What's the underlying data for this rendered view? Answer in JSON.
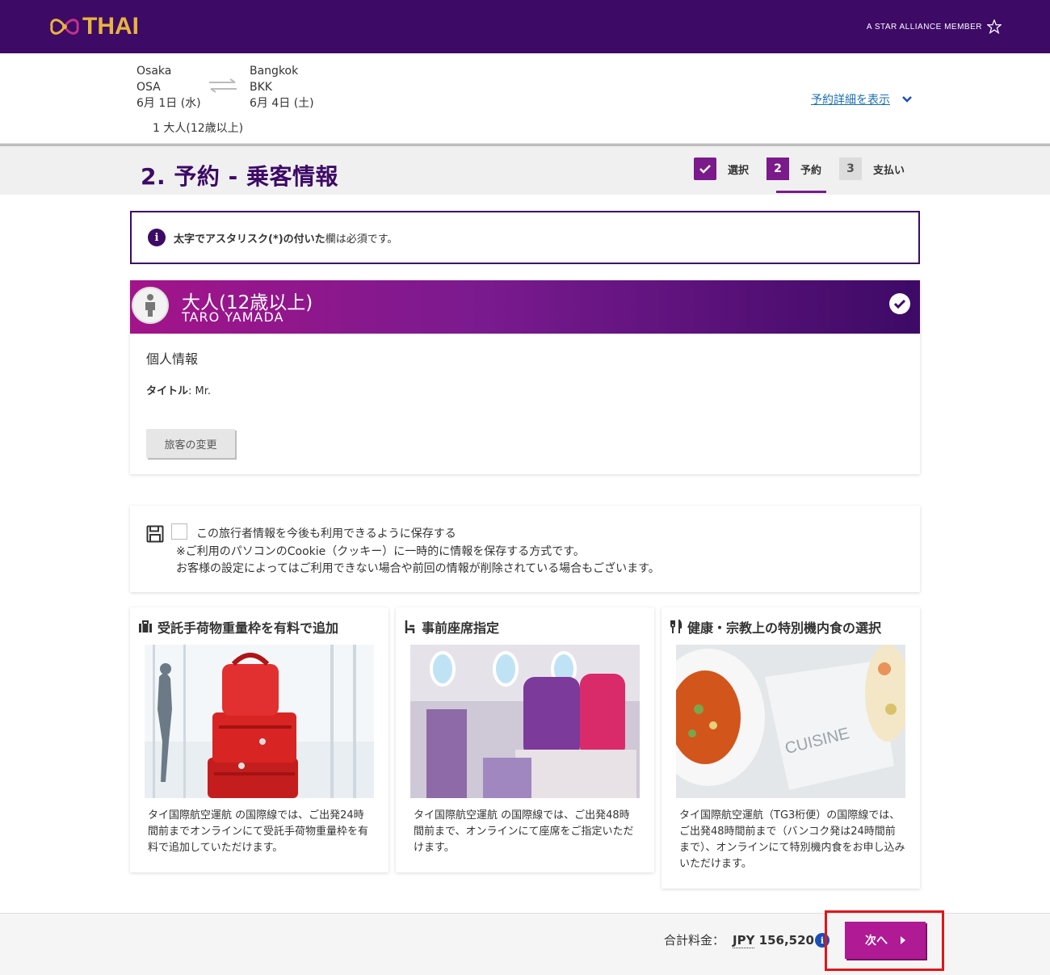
{
  "header": {
    "logo_text": "THAI",
    "alliance_text": "A STAR ALLIANCE MEMBER"
  },
  "trip": {
    "from": {
      "city": "Osaka",
      "code": "OSA",
      "date": "6月 1日 (水)"
    },
    "to": {
      "city": "Bangkok",
      "code": "BKK",
      "date": "6月 4日 (土)"
    },
    "passengers": "1 大人(12歳以上)",
    "details_link": "予約詳細を表示"
  },
  "page": {
    "title": "2. 予約 - 乗客情報",
    "steps": [
      {
        "number": "",
        "label": "選択",
        "state": "done"
      },
      {
        "number": "2",
        "label": "予約",
        "state": "active"
      },
      {
        "number": "3",
        "label": "支払い",
        "state": "pending"
      }
    ]
  },
  "notice": {
    "bold": "太字でアスタリスク(*)の付いた",
    "rest": "欄は必須です。"
  },
  "passenger": {
    "type": "大人(12歳以上)",
    "name": "TARO  YAMADA",
    "section": "個人情報",
    "title_label": "タイトル",
    "title_value": " Mr.",
    "change_button": "旅客の変更"
  },
  "save": {
    "line1": "この旅行者情報を今後も利用できるように保存する",
    "line2": "※ご利用のパソコンのCookie（クッキー）に一時的に情報を保存する方式です。",
    "line3": "お客様の設定によってはご利用できない場合や前回の情報が削除されている場合もございます。"
  },
  "services": [
    {
      "title": "受託手荷物重量枠を有料で追加",
      "icon": "suitcase-icon",
      "text": "タイ国際航空運航 の国際線では、ご出発24時間前までオンラインにて受託手荷物重量枠を有料で追加していただけます。"
    },
    {
      "title": "事前座席指定",
      "icon": "seat-icon",
      "text": "タイ国際航空運航 の国際線では、ご出発48時間前まで、オンラインにて座席をご指定いただけます。"
    },
    {
      "title": "健康・宗教上の特別機内食の選択",
      "icon": "cutlery-icon",
      "text": "タイ国際航空運航（TG3桁便）の国際線では、ご出発48時間前まで（バンコク発は24時間前まで）、オンラインにて特別機内食をお申し込みいただけます。",
      "image_text": "CUISINE"
    }
  ],
  "footer": {
    "total_label": "合計料金：",
    "currency": "JPY",
    "amount": "156,520",
    "next_button": "次へ"
  },
  "colors": {
    "brand_purple": "#3d0a66",
    "accent_magenta": "#b01a95",
    "logo_gold": "#e7b43d",
    "highlight_red": "#e0151a"
  }
}
